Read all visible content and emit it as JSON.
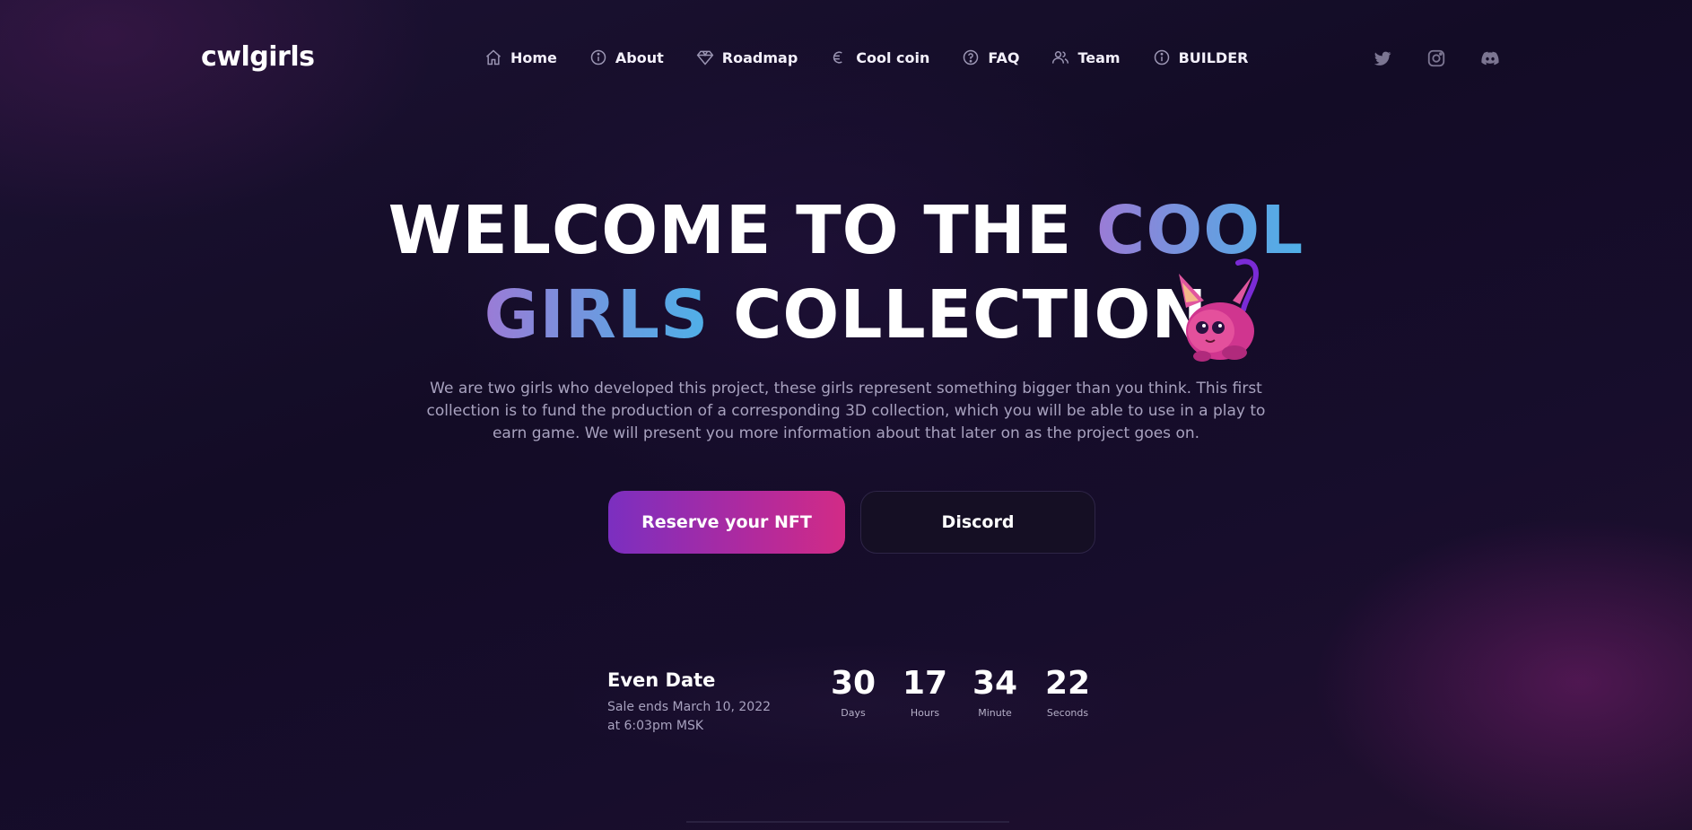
{
  "header": {
    "logo": "cwlgirls",
    "nav": [
      {
        "label": "Home",
        "icon": "home-icon"
      },
      {
        "label": "About",
        "icon": "info-icon"
      },
      {
        "label": "Roadmap",
        "icon": "diamond-icon"
      },
      {
        "label": "Cool coin",
        "icon": "coin-icon"
      },
      {
        "label": "FAQ",
        "icon": "question-icon"
      },
      {
        "label": "Team",
        "icon": "team-icon"
      },
      {
        "label": "BUILDER",
        "icon": "info-icon"
      }
    ],
    "social": [
      "twitter-icon",
      "instagram-icon",
      "discord-icon"
    ]
  },
  "hero": {
    "title_part1": "WELCOME TO THE ",
    "title_highlight1": "COOL",
    "title_highlight2": "GIRLS",
    "title_part2": " COLLECTION",
    "description": "We are two girls who developed this project, these girls represent something bigger than you think. This first collection is to fund the production of a corresponding 3D collection, which you will be able to use in a play to earn game. We will present you more information about that later on as the project goes on.",
    "primary_button": "Reserve your NFT",
    "secondary_button": "Discord"
  },
  "countdown": {
    "title": "Even Date",
    "subtitle": "Sale ends March 10, 2022 at 6:03pm MSK",
    "units": [
      {
        "value": "30",
        "label": "Days"
      },
      {
        "value": "17",
        "label": "Hours"
      },
      {
        "value": "34",
        "label": "Minute"
      },
      {
        "value": "22",
        "label": "Seconds"
      }
    ]
  },
  "colors": {
    "accent_start": "#7b2fc0",
    "accent_end": "#d22b86",
    "highlight_start": "#9b7bd6",
    "highlight_end": "#4fb0e8",
    "background": "#140d27"
  }
}
